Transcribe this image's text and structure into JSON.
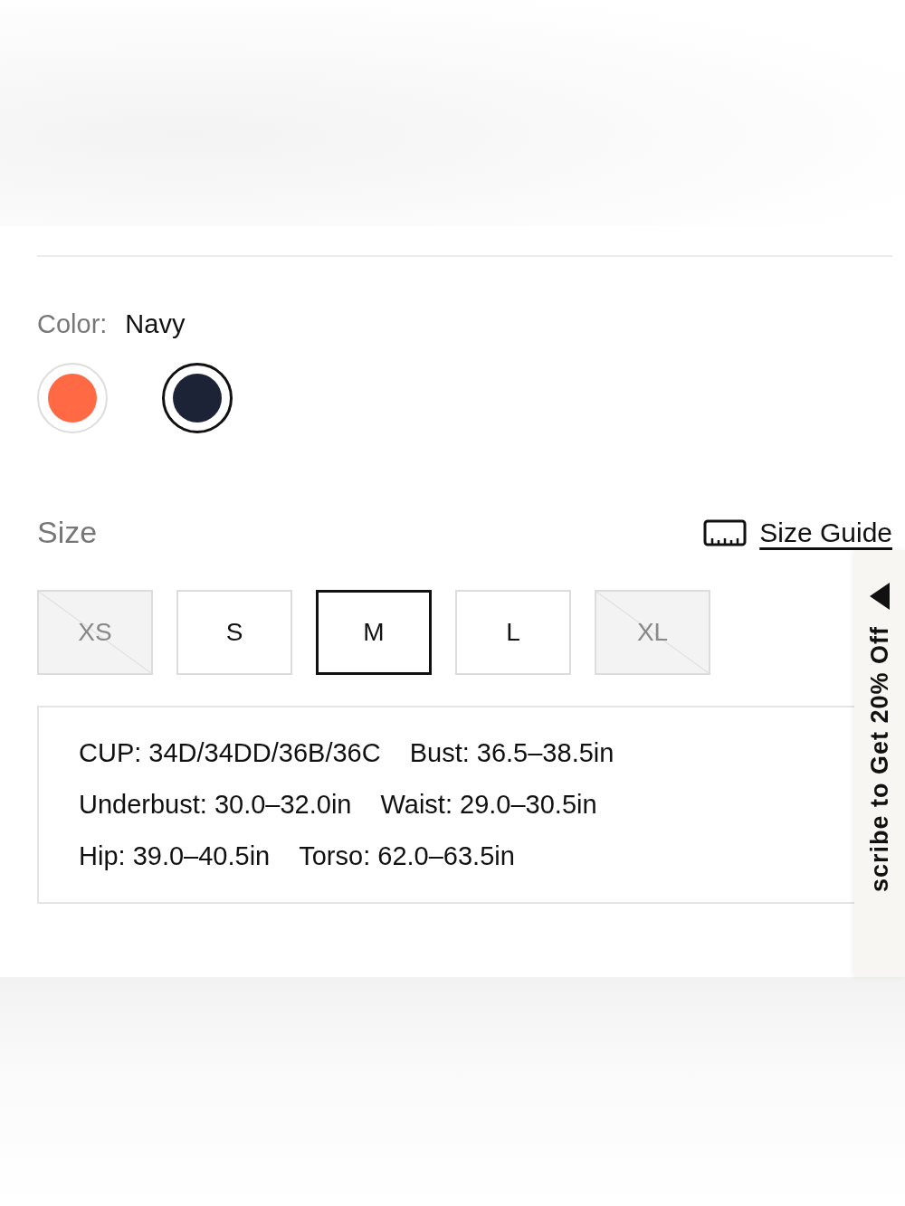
{
  "color": {
    "label": "Color:",
    "value": "Navy",
    "swatches": [
      {
        "color": "#ff6a45",
        "selected": false
      },
      {
        "color": "#1d2336",
        "selected": true
      }
    ]
  },
  "size": {
    "label": "Size",
    "guide": "Size Guide",
    "options": [
      {
        "label": "XS",
        "selected": false,
        "disabled": true
      },
      {
        "label": "S",
        "selected": false,
        "disabled": false
      },
      {
        "label": "M",
        "selected": true,
        "disabled": false
      },
      {
        "label": "L",
        "selected": false,
        "disabled": false
      },
      {
        "label": "XL",
        "selected": false,
        "disabled": true
      }
    ]
  },
  "measurements": [
    [
      "CUP: 34D/34DD/36B/36C",
      "Bust: 36.5–38.5in"
    ],
    [
      "Underbust: 30.0–32.0in",
      "Waist: 29.0–30.5in"
    ],
    [
      "Hip: 39.0–40.5in",
      "Torso: 62.0–63.5in"
    ]
  ],
  "promo_tab": {
    "text": "scribe to Get 20% Off"
  }
}
